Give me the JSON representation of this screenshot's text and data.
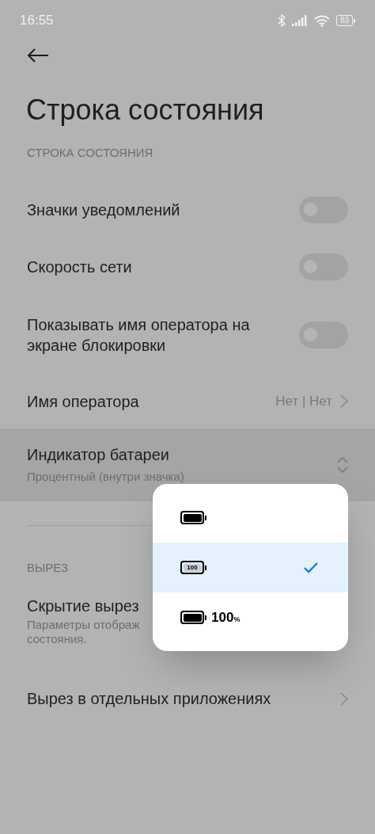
{
  "status_bar": {
    "time": "16:55",
    "battery": "83"
  },
  "title": "Строка состояния",
  "sections": [
    {
      "header": "СТРОКА СОСТОЯНИЯ",
      "items": [
        {
          "kind": "toggle",
          "label": "Значки уведомлений",
          "on": false
        },
        {
          "kind": "toggle",
          "label": "Скорость сети",
          "on": false
        },
        {
          "kind": "toggle",
          "label": "Показывать имя оператора на экране блокировки",
          "on": false
        },
        {
          "kind": "link",
          "label": "Имя оператора",
          "value": "Нет | Нет"
        },
        {
          "kind": "dropdown",
          "label": "Индикатор батареи",
          "description": "Процентный (внутри значка)",
          "expanded": true
        }
      ]
    },
    {
      "header": "ВЫРЕЗ",
      "items": [
        {
          "kind": "partial",
          "label": "Скрытие вырез",
          "description_lines": [
            "Параметры отображ",
            "состояния."
          ]
        },
        {
          "kind": "link",
          "label": "Вырез в отдельных приложениях"
        }
      ]
    }
  ],
  "battery_menu": [
    {
      "kind": "plain",
      "selected": false
    },
    {
      "kind": "inner_number",
      "text": "100",
      "selected": true
    },
    {
      "kind": "outer_number",
      "text": "100",
      "unit": "%",
      "selected": false
    }
  ]
}
